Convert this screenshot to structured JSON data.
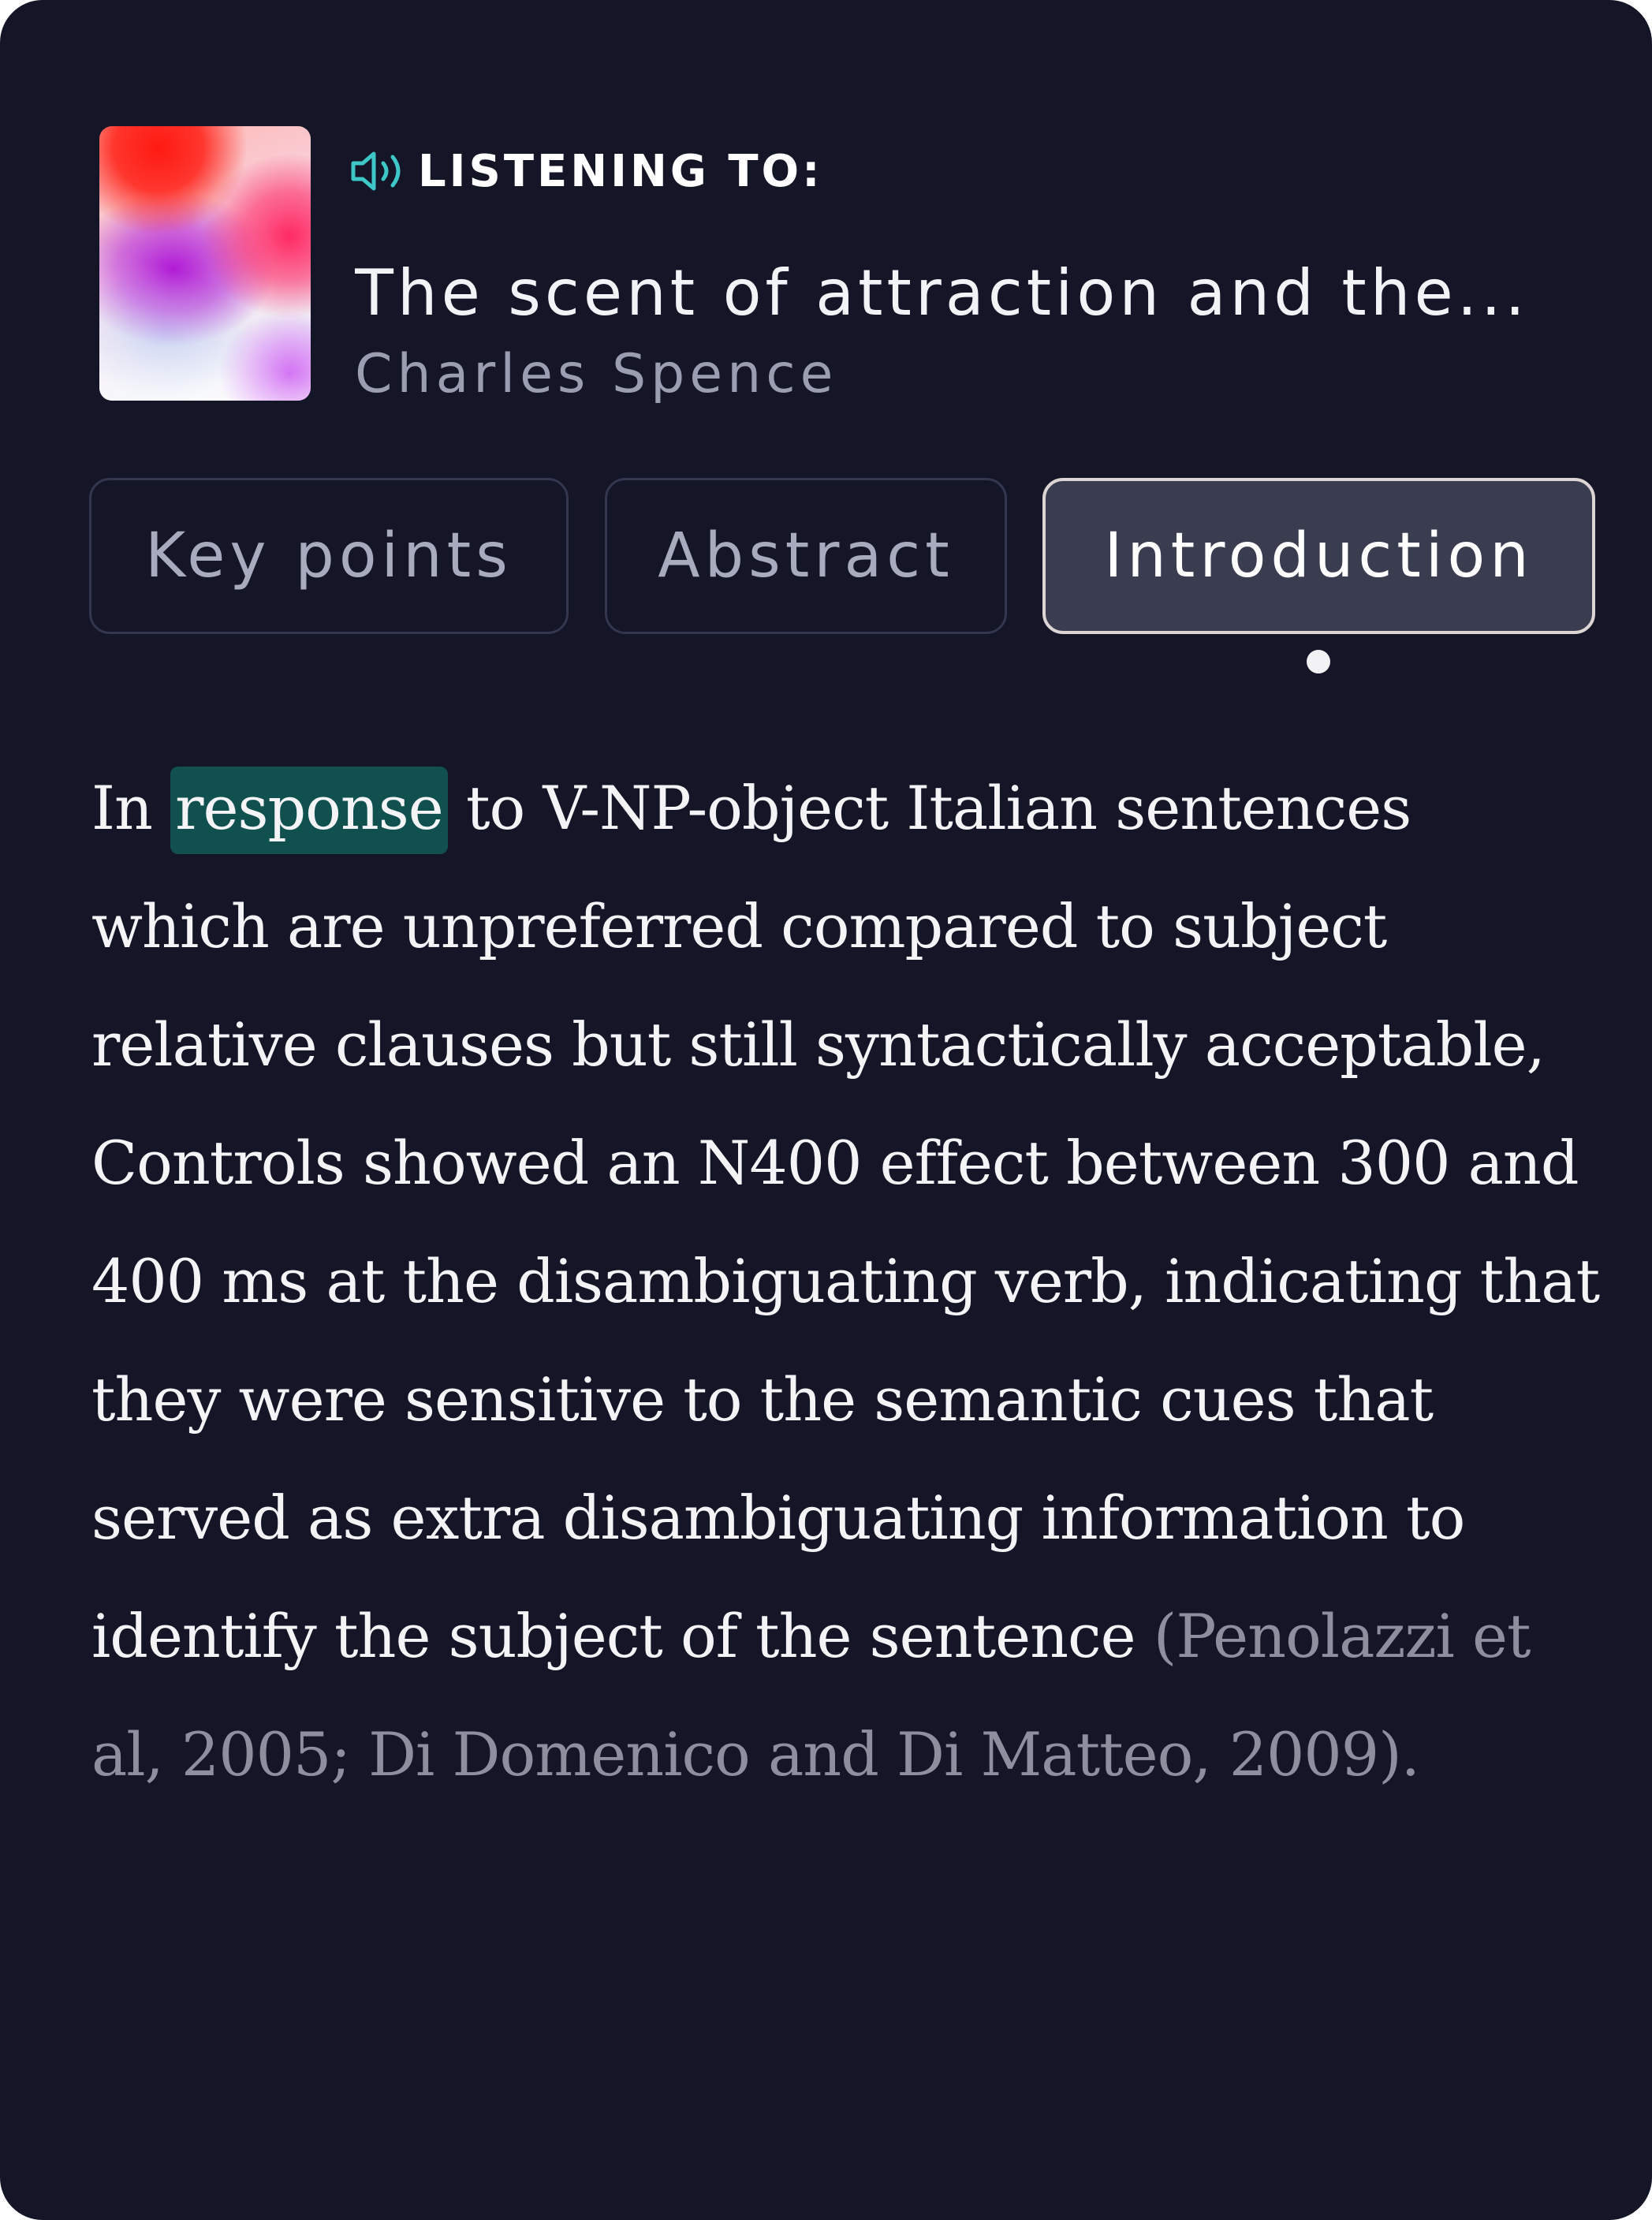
{
  "player": {
    "listening_label": "LISTENING TO:",
    "title": "The scent of attraction and the...",
    "author": "Charles Spence",
    "speaker_icon": "speaker-icon",
    "accent_color": "#3ec7c7"
  },
  "tabs": [
    {
      "label": "Key points",
      "active": false
    },
    {
      "label": "Abstract",
      "active": false
    },
    {
      "label": "Introduction",
      "active": true
    }
  ],
  "content": {
    "lead": "In",
    "highlighted_word": "response",
    "text": "to V-NP-object Italian sentences which are unpreferred compared to subject relative clauses but still syntactically acceptable, Controls showed an N400 effect between 300 and 400 ms at the disambiguating verb, indicating that they were sensitive to the semantic cues that served as extra disambiguating information to identify the subject of the sentence",
    "citation": "(Penolazzi et al, 2005; Di Domenico and Di Matteo, 2009)."
  }
}
